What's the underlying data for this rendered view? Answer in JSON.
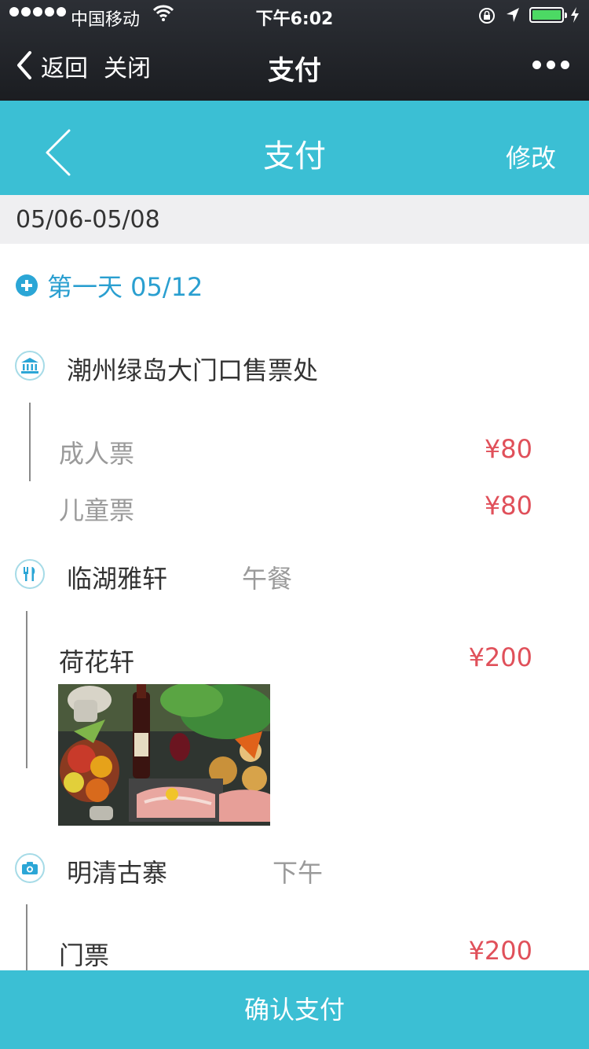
{
  "status_bar": {
    "carrier": "中国移动",
    "time": "下午6:02"
  },
  "wechat_nav": {
    "back_label": "返回",
    "close_label": "关闭",
    "title": "支付"
  },
  "app_header": {
    "title": "支付",
    "edit_label": "修改"
  },
  "date_range": "05/06-05/08",
  "day": {
    "label": "第一天 05/12"
  },
  "stops": [
    {
      "icon": "bank-icon",
      "name": "潮州绿岛大门口售票处",
      "items": [
        {
          "name": "成人票",
          "price": "¥80"
        },
        {
          "name": "儿童票",
          "price": "¥80"
        }
      ]
    },
    {
      "icon": "restaurant-icon",
      "name": "临湖雅轩",
      "tag": "午餐",
      "items": [
        {
          "name": "荷花轩",
          "price": "¥200"
        }
      ]
    },
    {
      "icon": "camera-icon",
      "name": "明清古寨",
      "tag": "下午",
      "items": [
        {
          "name": "门票",
          "price": "¥200"
        }
      ]
    }
  ],
  "confirm_button": "确认支付",
  "colors": {
    "accent": "#3bbfd4",
    "price": "#e0505a",
    "day_link": "#2a9fd0"
  }
}
